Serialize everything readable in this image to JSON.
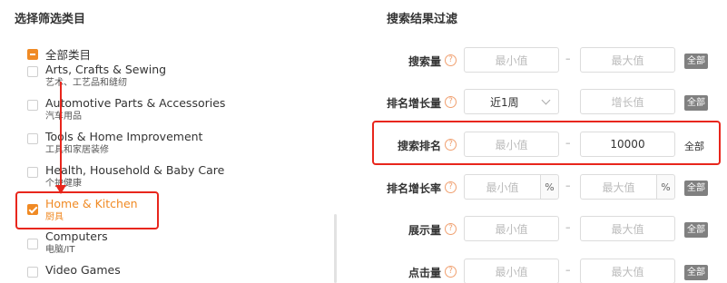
{
  "left_panel": {
    "title": "选择筛选类目",
    "all_label": "全部类目",
    "categories": [
      {
        "en": "Arts, Crafts & Sewing",
        "zh": "艺术、工艺品和缝纫",
        "checked": false
      },
      {
        "en": "Automotive Parts & Accessories",
        "zh": "汽车用品",
        "checked": false
      },
      {
        "en": "Tools & Home Improvement",
        "zh": "工具和家居装修",
        "checked": false
      },
      {
        "en": "Health, Household & Baby Care",
        "zh": "个护健康",
        "checked": false
      },
      {
        "en": "Home & Kitchen",
        "zh": "厨具",
        "checked": true
      },
      {
        "en": "Computers",
        "zh": "电脑/IT",
        "checked": false
      },
      {
        "en": "Video Games",
        "zh": "",
        "checked": false
      }
    ]
  },
  "right_panel": {
    "title": "搜索结果过滤",
    "help_glyph": "?",
    "dash": "–",
    "percent": "%",
    "all_label": "全部",
    "filters": [
      {
        "label": "搜索量",
        "min_placeholder": "最小值",
        "max_placeholder": "最大值"
      },
      {
        "label": "排名增长量",
        "period": "近1周",
        "growth_placeholder": "增长值"
      },
      {
        "label": "搜索排名",
        "min_placeholder": "最小值",
        "max_value": "10000"
      },
      {
        "label": "排名增长率",
        "min_placeholder": "最小值",
        "max_placeholder": "最大值"
      },
      {
        "label": "展示量",
        "min_placeholder": "最小值",
        "max_placeholder": "最大值"
      },
      {
        "label": "点击量",
        "min_placeholder": "最小值",
        "max_placeholder": "最大值"
      }
    ]
  },
  "colors": {
    "accent": "#f08a24",
    "highlight": "#e8261c",
    "badge": "#808080"
  },
  "icons": {
    "help": "question-circle-icon",
    "select": "chevron-down-icon",
    "check": "check-icon"
  }
}
